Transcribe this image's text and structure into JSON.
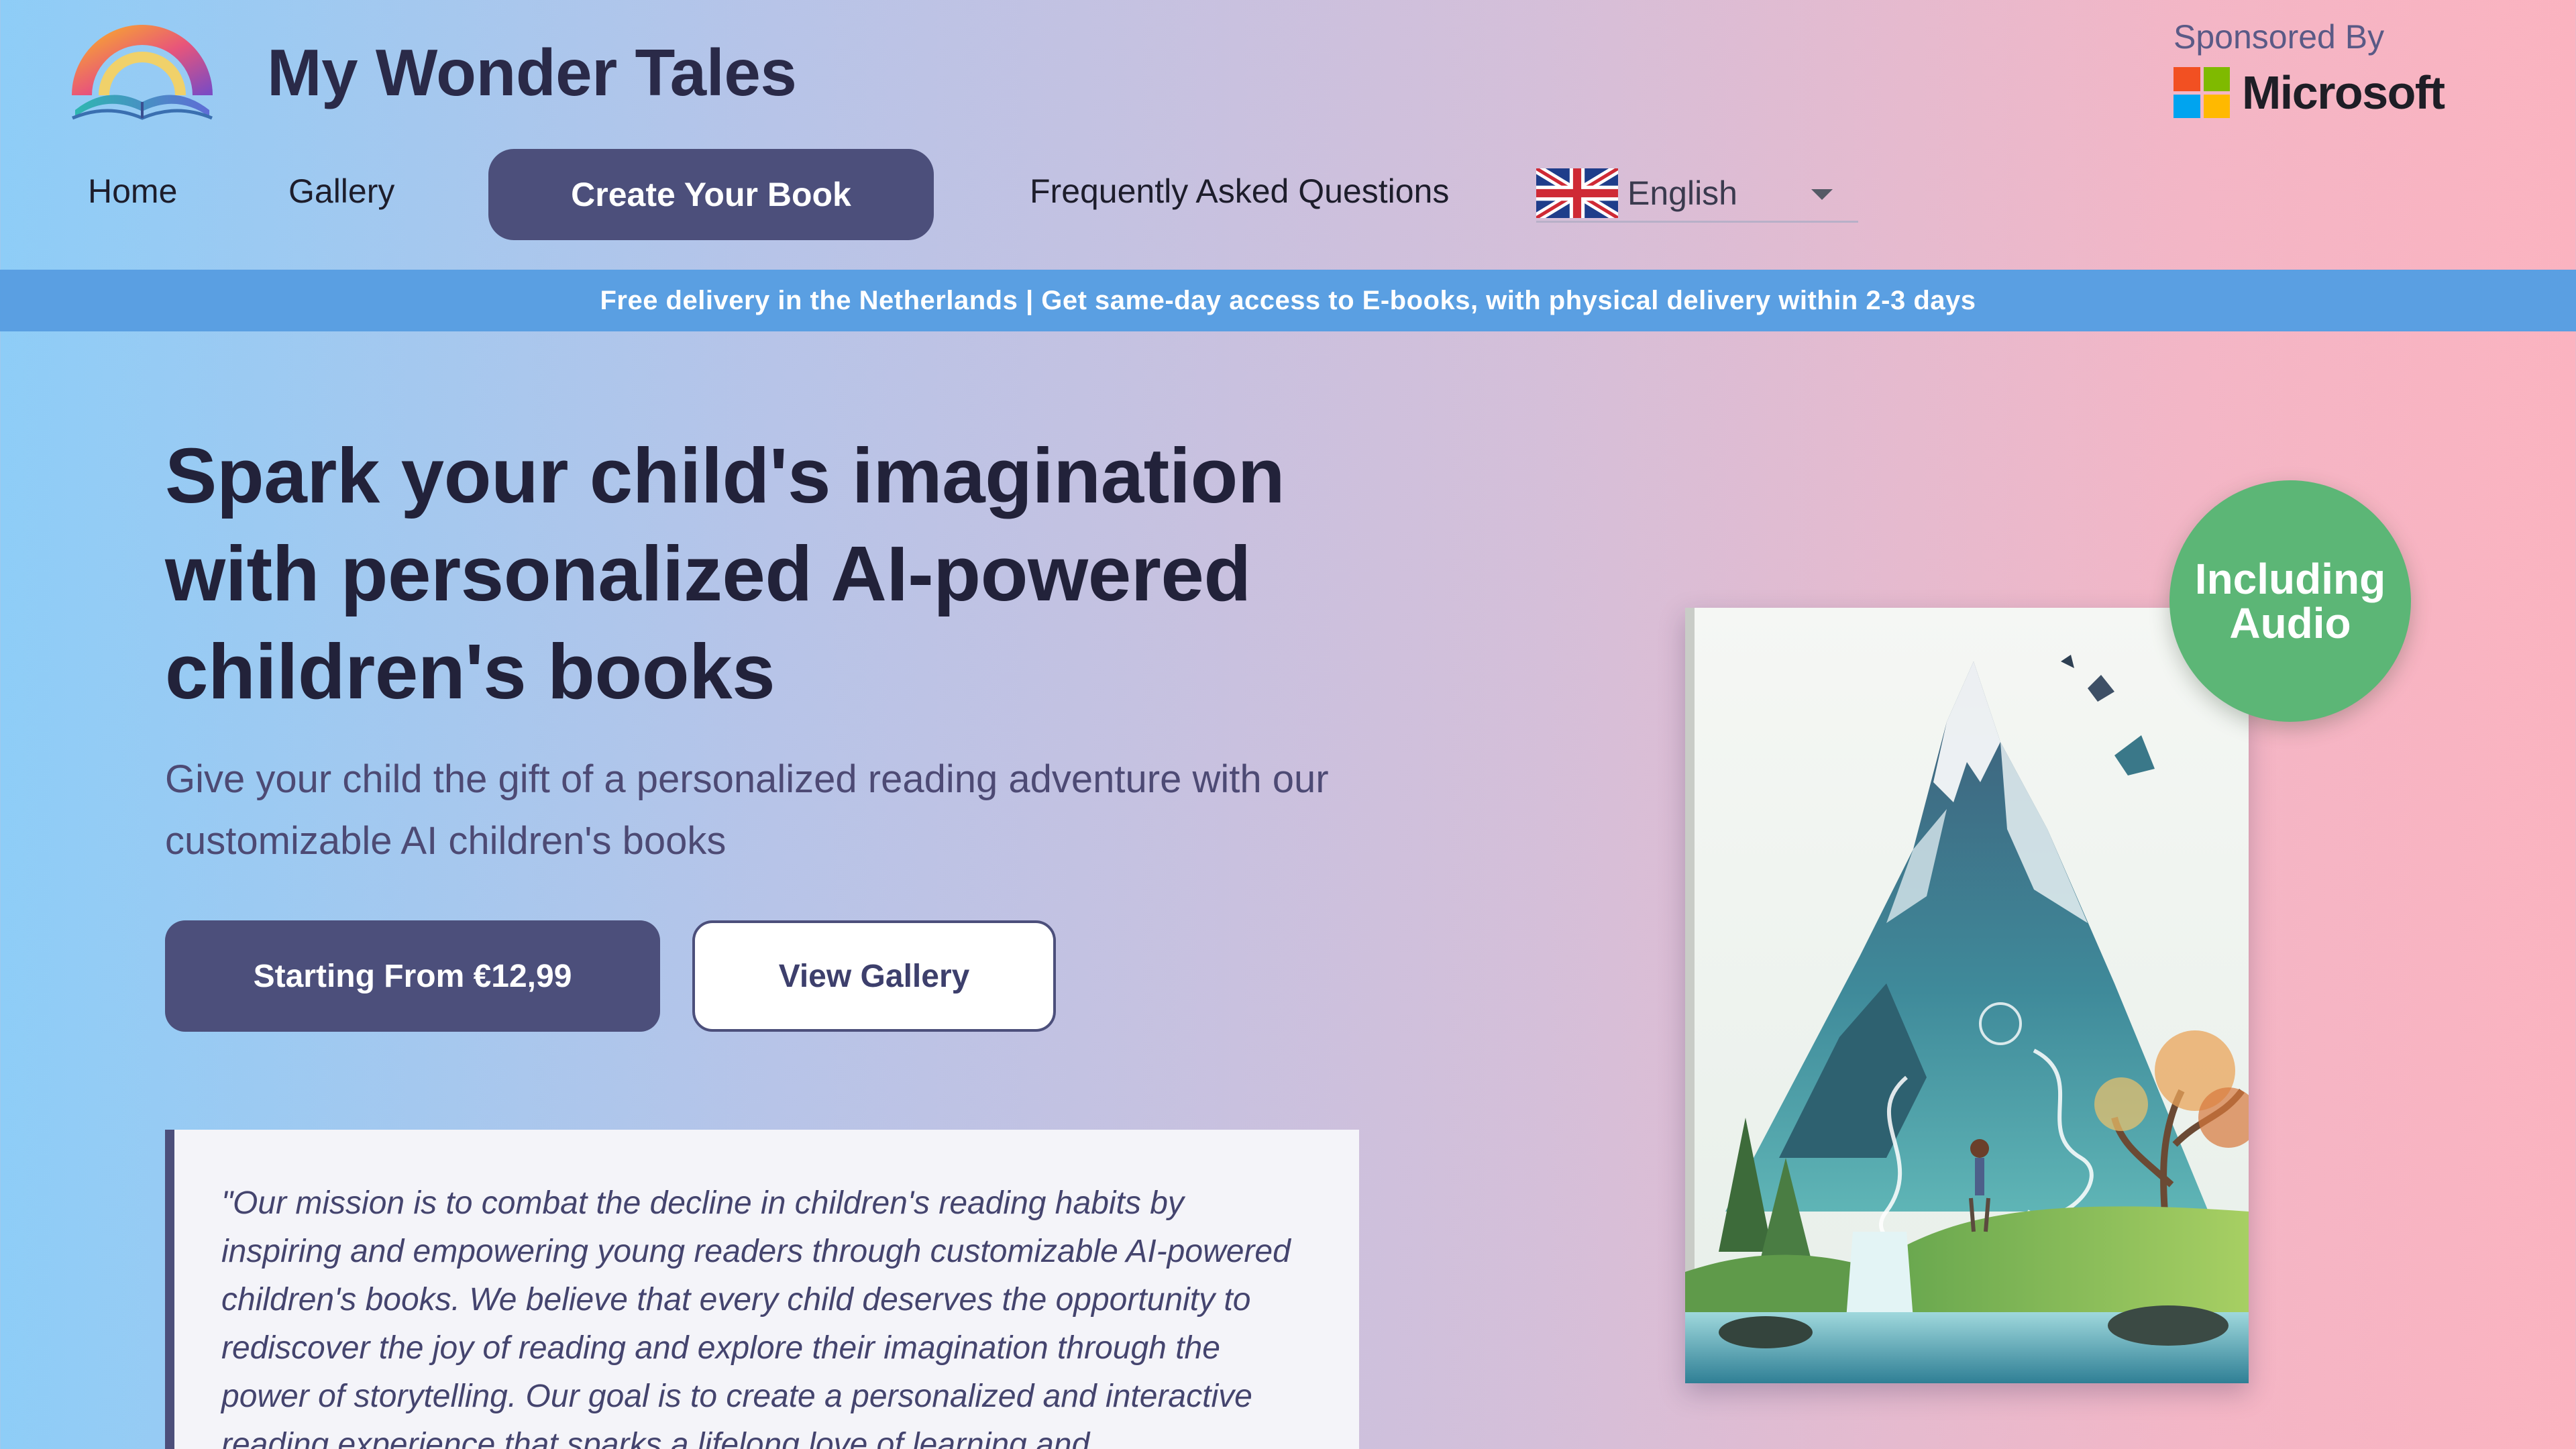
{
  "header": {
    "brand_name": "My Wonder Tales",
    "logo_icon": "rainbow-book-icon",
    "sponsor_label": "Sponsored By",
    "sponsor_name": "Microsoft"
  },
  "nav": {
    "home": "Home",
    "gallery": "Gallery",
    "create_book": "Create Your Book",
    "faq": "Frequently Asked Questions",
    "language": "English",
    "language_icon": "uk-flag-icon"
  },
  "banner": {
    "text": "Free delivery in the Netherlands | Get same-day access to E-books, with physical delivery within 2-3 days"
  },
  "hero": {
    "title": "Spark your child's imagination with personalized AI-powered children's books",
    "subtitle": "Give your child the gift of a personalized reading adventure with our customizable AI children's books",
    "primary_button": "Starting From €12,99",
    "secondary_button": "View Gallery",
    "badge": "Including Audio",
    "mission_quote": "\"Our mission is to combat the decline in children's reading habits by inspiring and empowering young readers through customizable AI-powered children's books. We believe that every child deserves the opportunity to rediscover the joy of reading and explore their imagination through the power of storytelling. Our goal is to create a personalized and interactive reading experience that sparks a lifelong love of learning and"
  },
  "colors": {
    "primary": "#4c4f7b",
    "banner": "#5a9fe2",
    "badge": "#5cb676",
    "text": "#22223a",
    "subtext": "#4d4a74"
  }
}
